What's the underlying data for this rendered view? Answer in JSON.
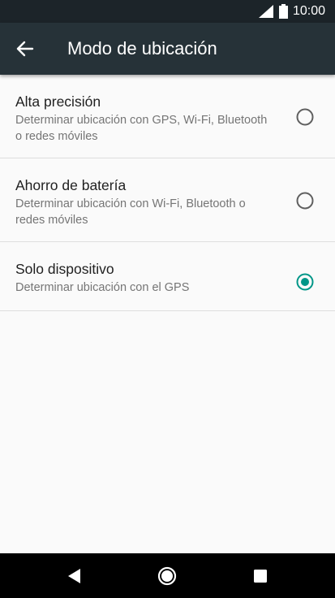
{
  "status_bar": {
    "time": "10:00",
    "icons": [
      "signal-icon",
      "battery-icon"
    ]
  },
  "app_bar": {
    "title": "Modo de ubicación",
    "back_icon": "arrow-back-icon"
  },
  "options": [
    {
      "label": "Alta precisión",
      "description": "Determinar ubicación con GPS, Wi-Fi, Bluetooth o redes móviles",
      "selected": false
    },
    {
      "label": "Ahorro de batería",
      "description": "Determinar ubicación con Wi-Fi, Bluetooth o redes móviles",
      "selected": false
    },
    {
      "label": "Solo dispositivo",
      "description": "Determinar ubicación con el GPS",
      "selected": true
    }
  ],
  "nav_bar": {
    "icons": [
      "back-triangle-icon",
      "home-circle-icon",
      "recents-square-icon"
    ]
  },
  "colors": {
    "status_bar": "#1c2429",
    "app_bar": "#263238",
    "accent": "#009688",
    "background": "#fafafa",
    "divider": "#dedede",
    "nav_bar": "#000000"
  }
}
